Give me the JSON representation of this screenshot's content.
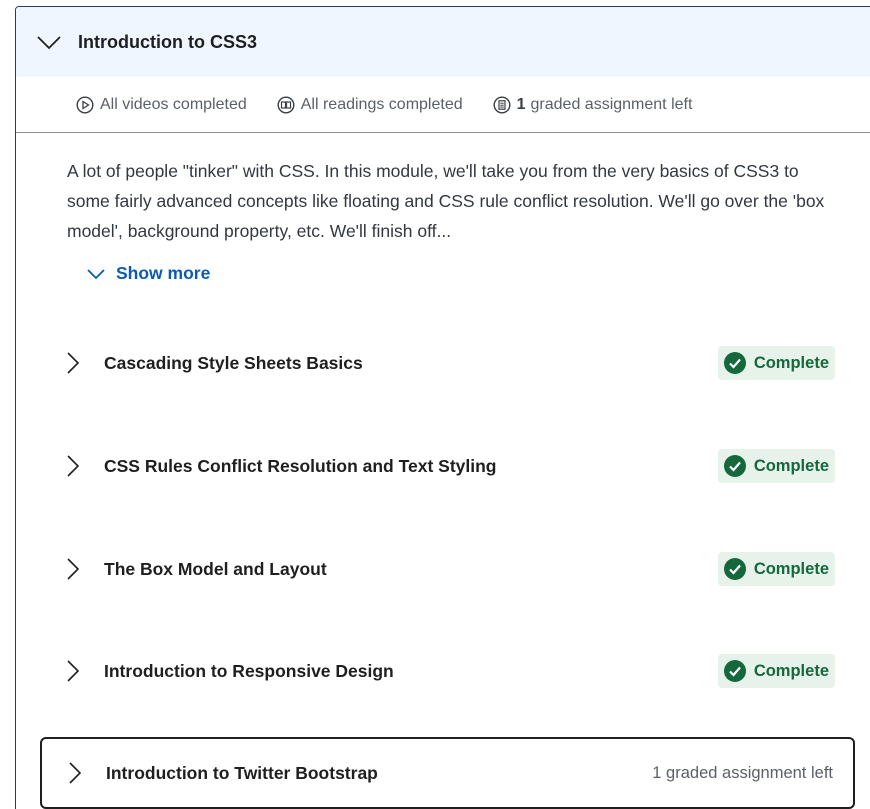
{
  "module": {
    "title": "Introduction to CSS3",
    "summary": {
      "videos": "All videos completed",
      "readings": "All readings completed",
      "graded_count": "1",
      "graded_text": "graded assignment left"
    },
    "description": "A lot of people \"tinker\" with CSS. In this module, we'll take you from the very basics of CSS3 to some fairly advanced concepts like floating and CSS rule conflict resolution. We'll go over the 'box model', background property, etc. We'll finish off...",
    "show_more": "Show more"
  },
  "lessons": [
    {
      "title": "Cascading Style Sheets Basics",
      "status": "Complete"
    },
    {
      "title": "CSS Rules Conflict Resolution and Text Styling",
      "status": "Complete"
    },
    {
      "title": "The Box Model and Layout",
      "status": "Complete"
    },
    {
      "title": "Introduction to Responsive Design",
      "status": "Complete"
    },
    {
      "title": "Introduction to Twitter Bootstrap",
      "status": "1 graded assignment left"
    }
  ],
  "colors": {
    "header_bg": "#f0f6ff",
    "link": "#0b5bb5",
    "complete_bg": "#e6f2ea",
    "complete_text": "#14683c"
  },
  "icons": {
    "collapse": "chevron-down-icon",
    "expand": "chevron-right-icon",
    "videos": "play-circle-icon",
    "readings": "book-icon",
    "graded": "assignment-icon",
    "complete": "check-circle-icon"
  }
}
